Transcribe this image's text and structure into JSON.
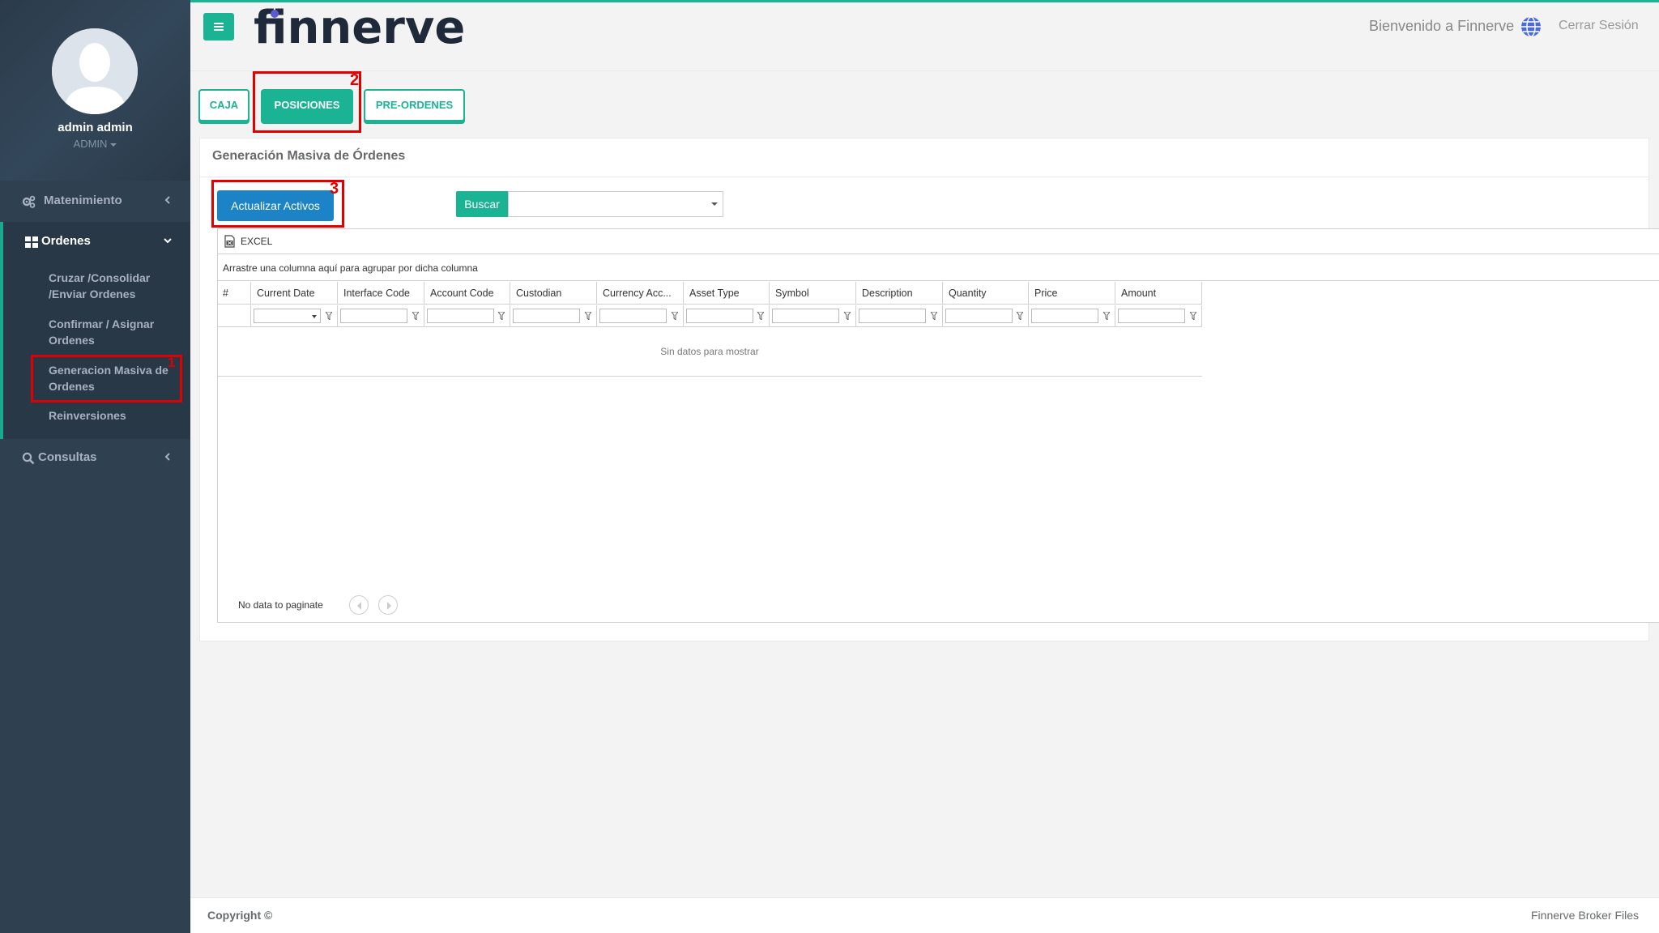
{
  "app": {
    "logo": "finnerve"
  },
  "user": {
    "name": "admin admin",
    "role": "ADMIN"
  },
  "sidebar": {
    "items": [
      {
        "label": "Matenimiento",
        "icon": "cogs-icon"
      },
      {
        "label": "Ordenes",
        "icon": "grid-icon"
      },
      {
        "label": "Consultas",
        "icon": "search-icon"
      }
    ],
    "sub_items": [
      {
        "label": "Cruzar /Consolidar /Enviar Ordenes"
      },
      {
        "label": "Confirmar / Asignar Ordenes"
      },
      {
        "label": "Generacion Masiva de Ordenes"
      },
      {
        "label": "Reinversiones"
      }
    ]
  },
  "header": {
    "welcome": "Bienvenido a Finnerve",
    "logout": "Cerrar Sesión"
  },
  "tabs": [
    {
      "label": "CAJA",
      "active": false
    },
    {
      "label": "POSICIONES",
      "active": true
    },
    {
      "label": "PRE-ORDENES",
      "active": false
    }
  ],
  "annotations": [
    "1",
    "2",
    "3"
  ],
  "panel": {
    "title": "Generación Masiva de Órdenes",
    "update_button": "Actualizar Activos",
    "search_label": "Buscar",
    "search_value": ""
  },
  "grid": {
    "export_label": "EXCEL",
    "group_hint": "Arrastre una columna aquí para agrupar por dicha columna",
    "columns": [
      "#",
      "Current Date",
      "Interface Code",
      "Account Code",
      "Custodian",
      "Currency Acc...",
      "Asset Type",
      "Symbol",
      "Description",
      "Quantity",
      "Price",
      "Amount"
    ],
    "empty_text": "Sin datos para mostrar",
    "paginate_text": "No data to paginate"
  },
  "footer": {
    "copyright": "Copyright ©",
    "brand": "Finnerve Broker Files"
  },
  "colors": {
    "accent": "#1ab394",
    "primary": "#1c84c6",
    "sidebar": "#2f4050",
    "annotation": "#e00000"
  }
}
